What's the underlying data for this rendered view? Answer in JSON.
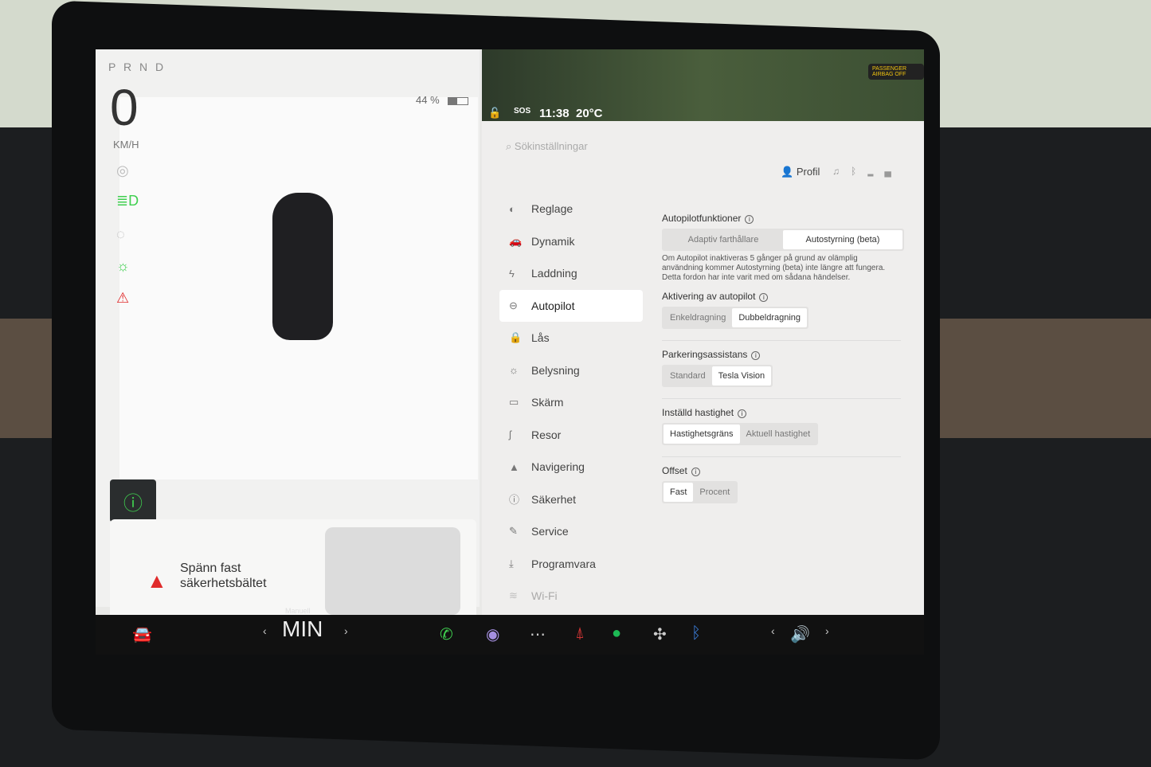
{
  "left": {
    "gear": "P R N D",
    "speed": "0",
    "unit": "KM/H",
    "battery": "44 %",
    "battery_pct": 44,
    "alert": "Spänn fast säkerhetsbältet"
  },
  "status": {
    "sos": "SOS",
    "time": "11:38",
    "temp": "20°C",
    "airbag": "PASSENGER AIRBAG OFF"
  },
  "search": {
    "placeholder": "Sökinställningar"
  },
  "header": {
    "profile": "Profil"
  },
  "nav": [
    {
      "label": "Reglage",
      "icon": "toggle-icon"
    },
    {
      "label": "Dynamik",
      "icon": "car-icon"
    },
    {
      "label": "Laddning",
      "icon": "bolt-icon"
    },
    {
      "label": "Autopilot",
      "icon": "steering-wheel-icon",
      "active": true
    },
    {
      "label": "Lås",
      "icon": "lock-icon"
    },
    {
      "label": "Belysning",
      "icon": "sun-icon"
    },
    {
      "label": "Skärm",
      "icon": "display-icon"
    },
    {
      "label": "Resor",
      "icon": "trips-icon"
    },
    {
      "label": "Navigering",
      "icon": "navigation-icon"
    },
    {
      "label": "Säkerhet",
      "icon": "safety-icon"
    },
    {
      "label": "Service",
      "icon": "wrench-icon"
    },
    {
      "label": "Programvara",
      "icon": "download-icon"
    },
    {
      "label": "Wi-Fi",
      "icon": "wifi-icon"
    }
  ],
  "content": {
    "autopilot_features": {
      "label": "Autopilotfunktioner",
      "options": [
        "Adaptiv farthållare",
        "Autostyrning (beta)"
      ],
      "selected": 1,
      "note": "Om Autopilot inaktiveras 5 gånger på grund av olämplig användning kommer Autostyrning (beta) inte längre att fungera. Detta fordon har inte varit med om sådana händelser."
    },
    "activation": {
      "label": "Aktivering av autopilot",
      "options": [
        "Enkeldragning",
        "Dubbeldragning"
      ],
      "selected": 1
    },
    "parking": {
      "label": "Parkeringsassistans",
      "options": [
        "Standard",
        "Tesla Vision"
      ],
      "selected": 1
    },
    "speed": {
      "label": "Inställd hastighet",
      "options": [
        "Hastighetsgräns",
        "Aktuell hastighet"
      ],
      "selected": 0
    },
    "offset": {
      "label": "Offset",
      "options": [
        "Fast",
        "Procent"
      ],
      "selected": 0
    }
  },
  "footer": {
    "mode_label": "Manuell",
    "mode": "MIN"
  },
  "colors": {
    "green": "#3fcf4f",
    "red": "#e02b2b",
    "airbag": "#f1c40f"
  }
}
